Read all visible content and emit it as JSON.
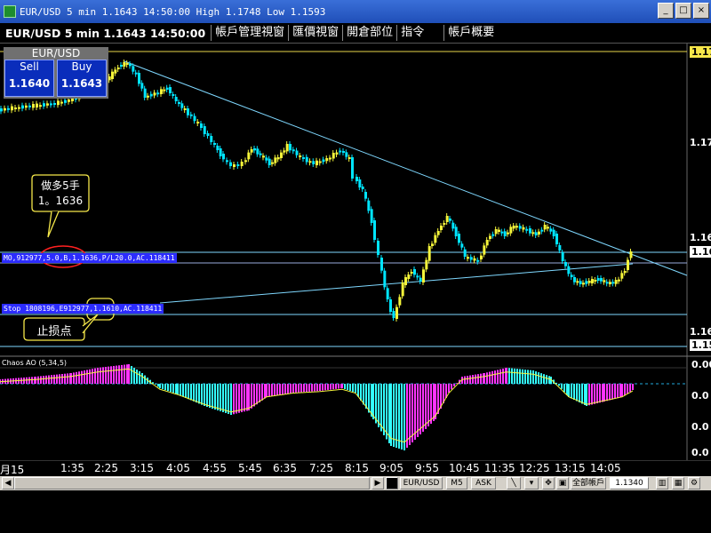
{
  "window": {
    "title": "EUR/USD 5 min 1.1643 14:50:00 High 1.1748 Low 1.1593",
    "minimize": "_",
    "restore": "□",
    "close": "×"
  },
  "menubar": {
    "instrument": "EUR/USD 5 min 1.1643 14:50:00",
    "items": [
      "帳戶管理視窗",
      "匯價視窗",
      "開倉部位",
      "指令",
      "帳戶概要"
    ]
  },
  "trade_panel": {
    "symbol": "EUR/USD",
    "sell_label": "Sell",
    "sell_price": "1.1640",
    "buy_label": "Buy",
    "buy_price": "1.1643"
  },
  "price_axis": {
    "labels": [
      "1.17",
      "1.17",
      "1.16",
      "1.16",
      "1.16",
      "1.15"
    ],
    "open_order_price_label": "1.16"
  },
  "orders": {
    "entry": "MO,912977,5.0,B,1.1636,P/L20.0,AC.118411",
    "stop": "Stop 1808196,E912977,1.1610,AC.118411"
  },
  "annotations": {
    "buy_note_line1": "做多5手",
    "buy_note_line2": "1。1636",
    "stop_note": "止损点"
  },
  "indicator": {
    "name": "Chaos AO (5,34,5)",
    "labels": [
      "0.00",
      "0.0",
      "0.0",
      "0.0"
    ]
  },
  "time_axis": [
    "月15",
    "1:35",
    "2:25",
    "3:15",
    "4:05",
    "4:55",
    "5:45",
    "6:35",
    "7:25",
    "8:15",
    "9:05",
    "9:55",
    "10:45",
    "11:35",
    "12:25",
    "13:15",
    "14:05"
  ],
  "toolbar": {
    "symbol": "EUR/USD",
    "period": "M5",
    "side": "ASK",
    "account": "全部帳戶",
    "value": "1.1340"
  },
  "colors": {
    "bull_candle": "#f5f53a",
    "bear_candle": "#00e5ff",
    "trendline": "#7fd8ff",
    "ao_up": "#ff33ff",
    "ao_down": "#33ffff"
  }
}
